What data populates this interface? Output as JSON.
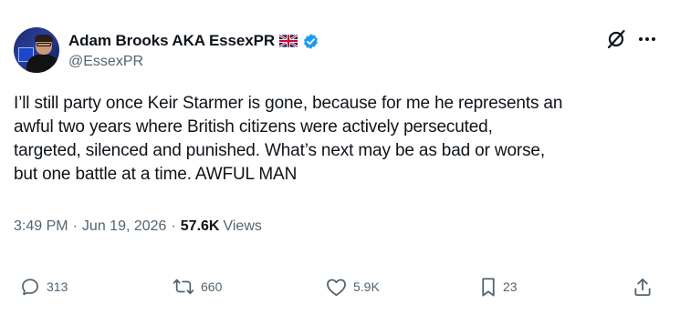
{
  "author": {
    "display_name": "Adam Brooks AKA EssexPR",
    "handle": "@EssexPR",
    "flag_icon": "uk-flag-icon",
    "verified_icon": "verified-badge-icon",
    "verified_color": "#1d9bf0"
  },
  "tweet": {
    "lines": [
      "I’ll still party once Keir Starmer is gone, because for me he represents an",
      "awful two years where British citizens were actively persecuted,",
      "targeted, silenced and punished. What’s next may be as bad or worse,",
      "but one battle at a time. AWFUL MAN"
    ]
  },
  "meta": {
    "time": "3:49 PM",
    "separator": "·",
    "date": "Jun 19, 2026",
    "views_count": "57.6K",
    "views_label": "Views"
  },
  "actions": {
    "replies": "313",
    "reposts": "660",
    "likes": "5.9K",
    "bookmarks": "23"
  },
  "colors": {
    "text_primary": "#0f1419",
    "text_secondary": "#536471",
    "accent": "#1d9bf0"
  }
}
